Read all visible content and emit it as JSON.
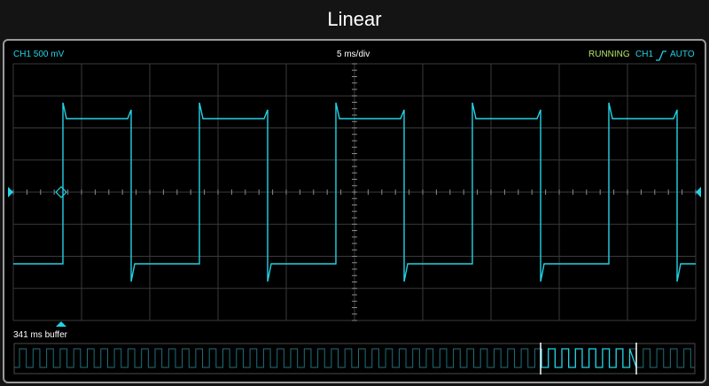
{
  "title": "Linear",
  "status": {
    "channel_label": "CH1 500 mV",
    "timebase": "5 ms/div",
    "run_state": "RUNNING",
    "trigger_channel": "CH1",
    "trigger_mode": "AUTO",
    "trigger_edge_icon": "rising-edge-icon"
  },
  "buffer_label": "341 ms buffer",
  "colors": {
    "trace": "#22d3e6",
    "grid": "#3a3a3a",
    "run_state": "#b6e36a",
    "text": "#ffffff"
  }
}
